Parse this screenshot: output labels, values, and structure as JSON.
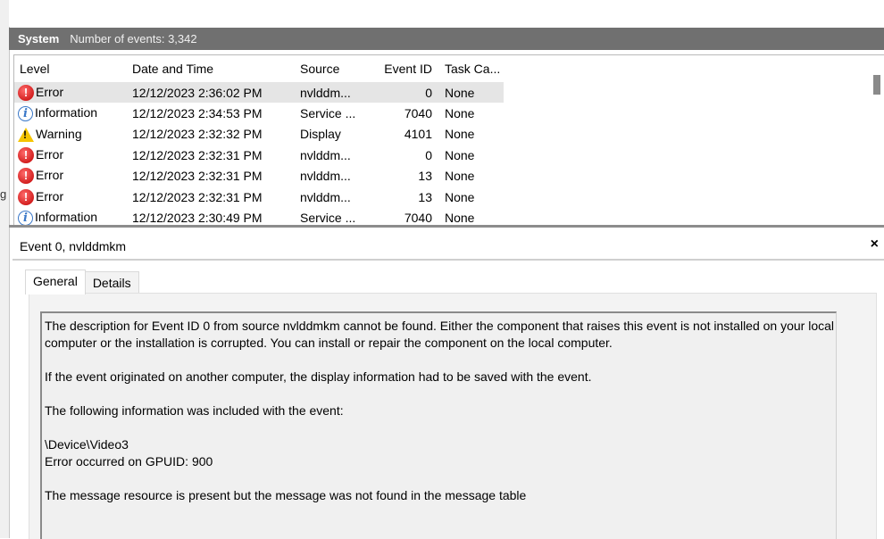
{
  "header": {
    "log_name": "System",
    "event_count": "Number of events: 3,342"
  },
  "columns": [
    "Level",
    "Date and Time",
    "Source",
    "Event ID",
    "Task Ca..."
  ],
  "events": [
    {
      "level": "Error",
      "icon": "error-icon",
      "datetime": "12/12/2023 2:36:02 PM",
      "source": "nvlddm...",
      "event_id": "0",
      "task": "None",
      "selected": true
    },
    {
      "level": "Information",
      "icon": "info-icon",
      "datetime": "12/12/2023 2:34:53 PM",
      "source": "Service ...",
      "event_id": "7040",
      "task": "None"
    },
    {
      "level": "Warning",
      "icon": "warning-icon",
      "datetime": "12/12/2023 2:32:32 PM",
      "source": "Display",
      "event_id": "4101",
      "task": "None"
    },
    {
      "level": "Error",
      "icon": "error-icon",
      "datetime": "12/12/2023 2:32:31 PM",
      "source": "nvlddm...",
      "event_id": "0",
      "task": "None"
    },
    {
      "level": "Error",
      "icon": "error-icon",
      "datetime": "12/12/2023 2:32:31 PM",
      "source": "nvlddm...",
      "event_id": "13",
      "task": "None"
    },
    {
      "level": "Error",
      "icon": "error-icon",
      "datetime": "12/12/2023 2:32:31 PM",
      "source": "nvlddm...",
      "event_id": "13",
      "task": "None"
    },
    {
      "level": "Information",
      "icon": "info-icon",
      "datetime": "12/12/2023 2:30:49 PM",
      "source": "Service ...",
      "event_id": "7040",
      "task": "None"
    }
  ],
  "detail": {
    "title": "Event 0, nvlddmkm",
    "close_glyph": "×",
    "tabs": [
      "General",
      "Details"
    ],
    "description": {
      "para1": "The description for Event ID 0 from source nvlddmkm cannot be found. Either the component that raises this event is not installed on your local computer or the installation is corrupted. You can install or repair the component on the local computer.",
      "para2": "If the event originated on another computer, the display information had to be saved with the event.",
      "para3": "The following information was included with the event:",
      "line4a": "\\Device\\Video3",
      "line4b": "Error occurred on GPUID: 900",
      "para5": "The message resource is present but the message was not found in the message table"
    }
  },
  "colors": {
    "header_bg": "#707070",
    "selected_row": "#e5e5e5",
    "error": "#c10000",
    "warning": "#f5c400",
    "info": "#3a78c8"
  }
}
